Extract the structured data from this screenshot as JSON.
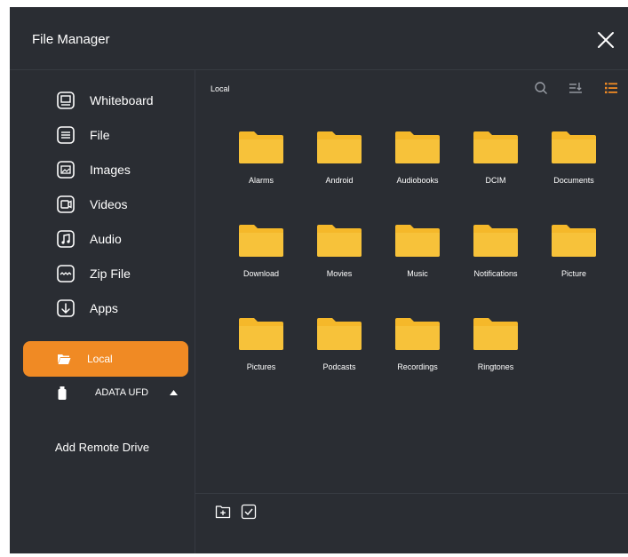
{
  "window": {
    "title": "File Manager"
  },
  "sidebar": {
    "categories": [
      {
        "label": "Whiteboard",
        "icon": "whiteboard-icon"
      },
      {
        "label": "File",
        "icon": "file-icon"
      },
      {
        "label": "Images",
        "icon": "images-icon"
      },
      {
        "label": "Videos",
        "icon": "videos-icon"
      },
      {
        "label": "Audio",
        "icon": "audio-icon"
      },
      {
        "label": "Zip File",
        "icon": "zip-file-icon"
      },
      {
        "label": "Apps",
        "icon": "apps-icon"
      }
    ],
    "local": {
      "label": "Local",
      "icon": "folder-open-icon",
      "selected": true
    },
    "usb": {
      "label": "ADATA UFD",
      "icon": "usb-drive-icon",
      "expanded": true
    },
    "remote_label": "Add Remote Drive"
  },
  "main": {
    "breadcrumb": "Local",
    "toolbar": {
      "search_icon": "search-icon",
      "sort_icon": "sort-icon",
      "view_icon": "list-view-icon"
    },
    "folders": [
      "Alarms",
      "Android",
      "Audiobooks",
      "DCIM",
      "Documents",
      "Download",
      "Movies",
      "Music",
      "Notifications",
      "Picture",
      "Pictures",
      "Podcasts",
      "Recordings",
      "Ringtones"
    ],
    "bottom_tools": {
      "new_folder_icon": "new-folder-icon",
      "select_icon": "select-checkbox-icon"
    }
  },
  "colors": {
    "background": "#2a2d33",
    "accent": "#f08a24",
    "folder": "#f5b82a",
    "text": "#ffffff",
    "icon_gray": "#9a9ea6"
  }
}
